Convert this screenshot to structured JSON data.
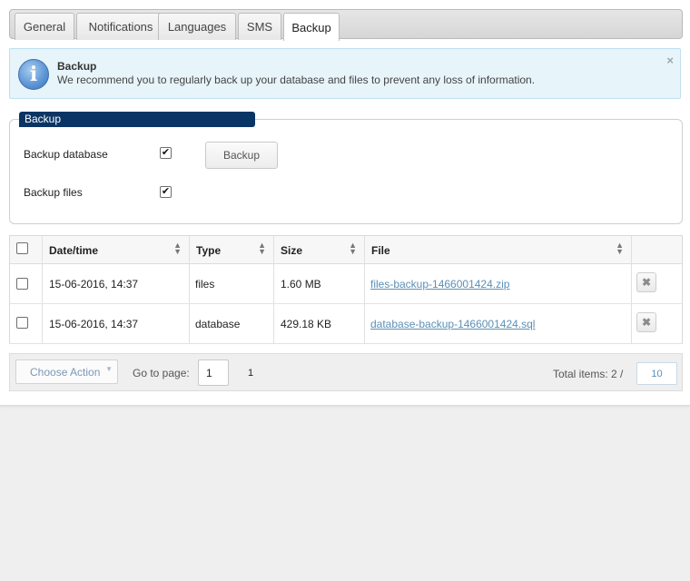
{
  "tabs": [
    {
      "label": "General"
    },
    {
      "label": "Notifications"
    },
    {
      "label": "Languages"
    },
    {
      "label": "SMS"
    },
    {
      "label": "Backup"
    }
  ],
  "info": {
    "title": "Backup",
    "text": "We recommend you to regularly back up your database and files to prevent any loss of information.",
    "close": "×",
    "icon_glyph": "i"
  },
  "backup_form": {
    "legend": "Backup",
    "database_label": "Backup database",
    "database_checked": true,
    "files_label": "Backup files",
    "files_checked": true,
    "button_label": "Backup",
    "check_glyph": "✔"
  },
  "table": {
    "columns": [
      "Date/time",
      "Type",
      "Size",
      "File"
    ],
    "rows": [
      {
        "datetime": "15-06-2016, 14:37",
        "type": "files",
        "size": "1.60 MB",
        "file": "files-backup-1466001424.zip"
      },
      {
        "datetime": "15-06-2016, 14:37",
        "type": "database",
        "size": "429.18 KB",
        "file": "database-backup-1466001424.sql"
      }
    ],
    "delete_glyph": "✖"
  },
  "footer": {
    "action_label": "Choose Action",
    "goto_label": "Go to page:",
    "page_value": "1",
    "page_count": "1",
    "total_label": "Total items: 2 /",
    "per_page": "10"
  }
}
